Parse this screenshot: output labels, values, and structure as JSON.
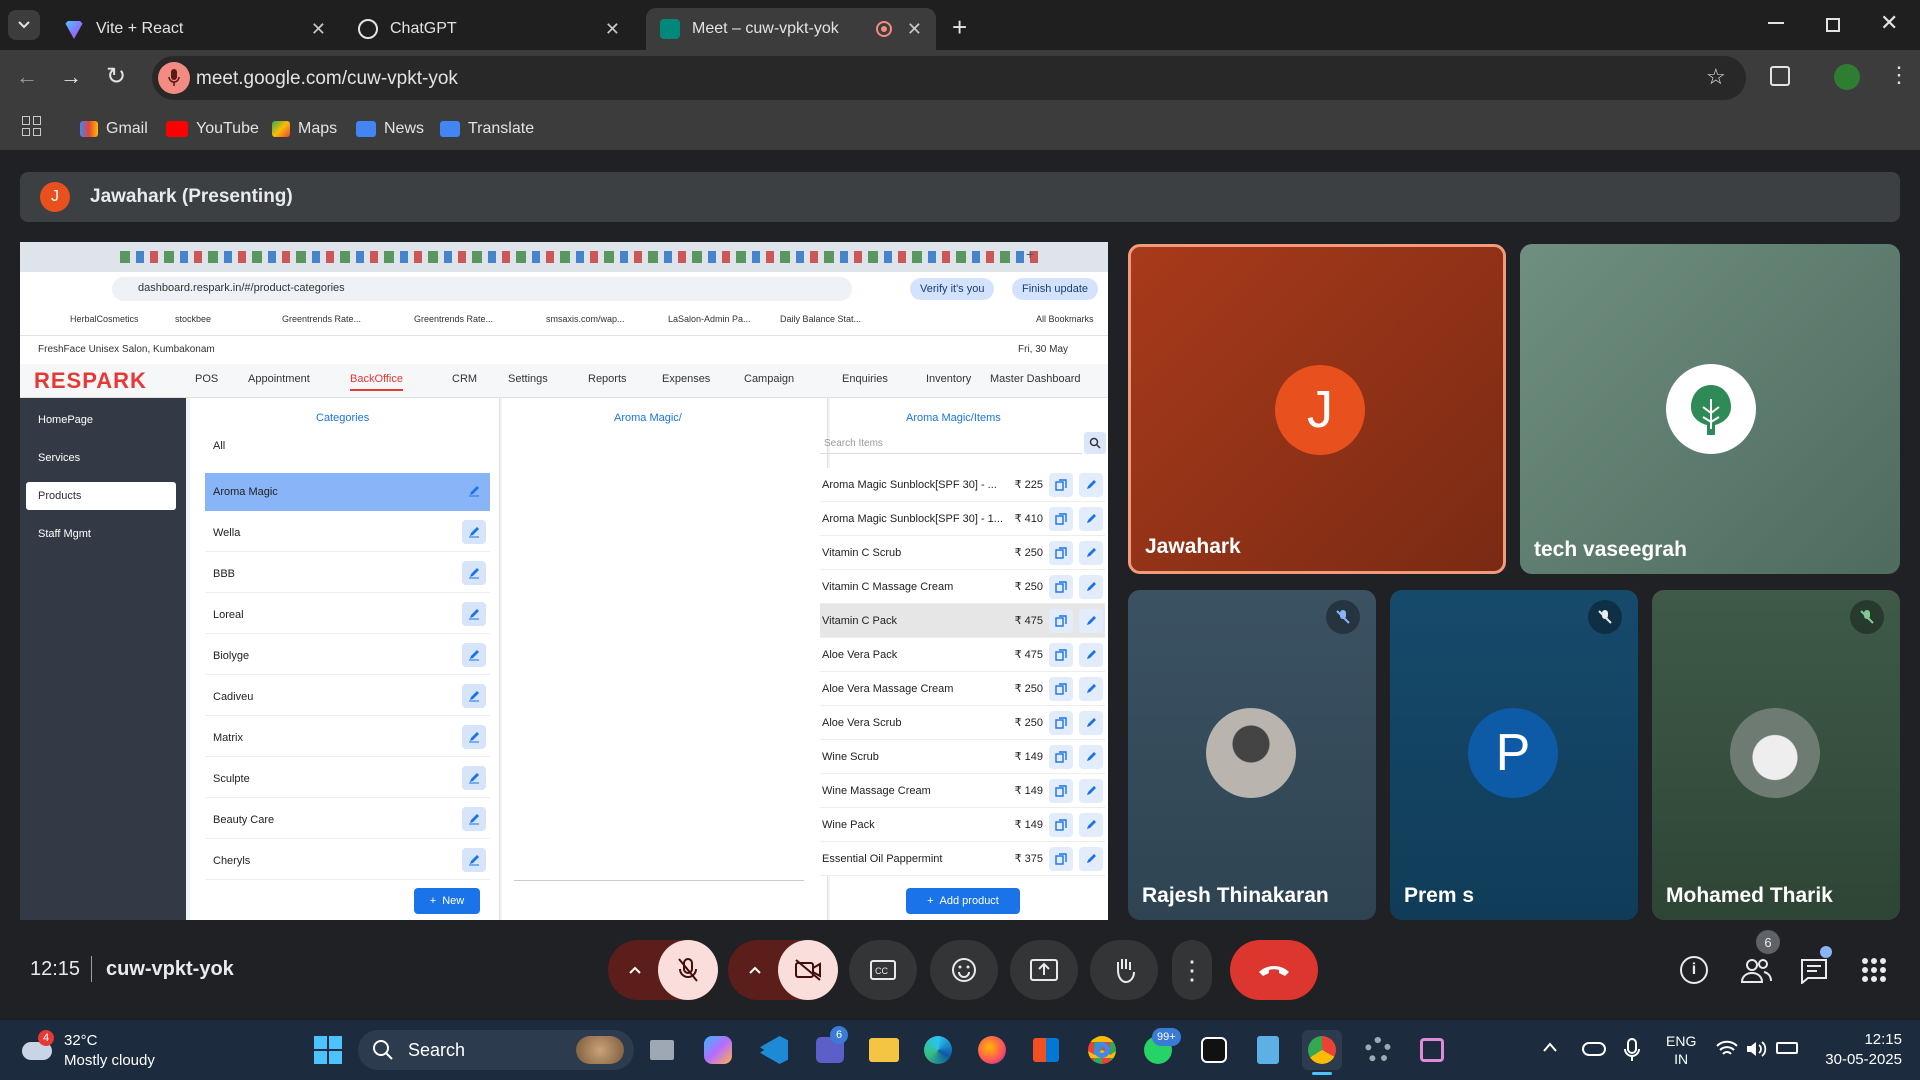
{
  "browser": {
    "tabs": [
      {
        "title": "Vite + React",
        "icon": "vite-icon"
      },
      {
        "title": "ChatGPT",
        "icon": "chatgpt-icon"
      },
      {
        "title": "Meet – cuw-vpkt-yok",
        "icon": "meet-icon",
        "active": true
      }
    ],
    "url": "meet.google.com/cuw-vpkt-yok",
    "bookmarks": [
      "Gmail",
      "YouTube",
      "Maps",
      "News",
      "Translate"
    ]
  },
  "meet": {
    "presenter_initial": "J",
    "presenter_label": "Jawahark (Presenting)",
    "participants": [
      {
        "name": "Jawahark",
        "initial": "J",
        "color": "#e8501e"
      },
      {
        "name": "tech vaseegrah",
        "initial": "",
        "color": "#ffffff"
      },
      {
        "name": "Rajesh Thinakaran",
        "initial": "",
        "color": "#8a8f96"
      },
      {
        "name": "Prem s",
        "initial": "P",
        "color": "#0d5aa7"
      },
      {
        "name": "Mohamed Tharik",
        "initial": "",
        "color": "#6e7b73"
      }
    ],
    "time": "12:15",
    "meeting_code": "cuw-vpkt-yok",
    "people_count": "6"
  },
  "shared_screen": {
    "url": "dashboard.respark.in/#/product-categories",
    "verify_label": "Verify it's you",
    "finish_label": "Finish update",
    "bookmarks": [
      "HerbalCosmetics",
      "stockbee",
      "Greentrends Rate...",
      "Greentrends Rate...",
      "smsaxis.com/wap...",
      "LaSalon-Admin Pa...",
      "Daily Balance Stat...",
      "All Bookmarks"
    ],
    "salon": "FreshFace Unisex Salon, Kumbakonam",
    "date": "Fri, 30 May",
    "logo": "RESPARK",
    "nav": [
      "POS",
      "Appointment",
      "BackOffice",
      "CRM",
      "Settings",
      "Reports",
      "Expenses",
      "Campaign",
      "Enquiries",
      "Inventory",
      "Master Dashboard"
    ],
    "side": [
      "HomePage",
      "Services",
      "Products",
      "Staff Mgmt"
    ],
    "categories_title": "Categories",
    "all_label": "All",
    "categories": [
      "Aroma Magic",
      "Wella",
      "BBB",
      "Loreal",
      "Biolyge",
      "Cadiveu",
      "Matrix",
      "Sculpte",
      "Beauty Care",
      "Cheryls"
    ],
    "middle_title": "Aroma Magic/",
    "items_title": "Aroma Magic/Items",
    "search_placeholder": "Search Items",
    "items": [
      {
        "name": "Aroma Magic Sunblock[SPF 30] - ...",
        "price": "₹ 225"
      },
      {
        "name": "Aroma Magic Sunblock[SPF 30] - 1...",
        "price": "₹ 410"
      },
      {
        "name": "Vitamin C Scrub",
        "price": "₹ 250"
      },
      {
        "name": "Vitamin C Massage Cream",
        "price": "₹ 250"
      },
      {
        "name": "Vitamin C Pack",
        "price": "₹ 475"
      },
      {
        "name": "Aloe Vera Pack",
        "price": "₹ 475"
      },
      {
        "name": "Aloe Vera Massage Cream",
        "price": "₹ 250"
      },
      {
        "name": "Aloe Vera Scrub",
        "price": "₹ 250"
      },
      {
        "name": "Wine Scrub",
        "price": "₹ 149"
      },
      {
        "name": "Wine Massage Cream",
        "price": "₹ 149"
      },
      {
        "name": "Wine Pack",
        "price": "₹ 149"
      },
      {
        "name": "Essential Oil Pappermint",
        "price": "₹ 375"
      }
    ],
    "new_label": "New",
    "add_product_label": "Add product"
  },
  "taskbar": {
    "weather_badge": "4",
    "temp": "32°C",
    "condition": "Mostly cloudy",
    "search": "Search",
    "teams_badge": "6",
    "whatsapp_badge": "99+",
    "lang1": "ENG",
    "lang2": "IN",
    "time": "12:15",
    "date": "30-05-2025"
  }
}
